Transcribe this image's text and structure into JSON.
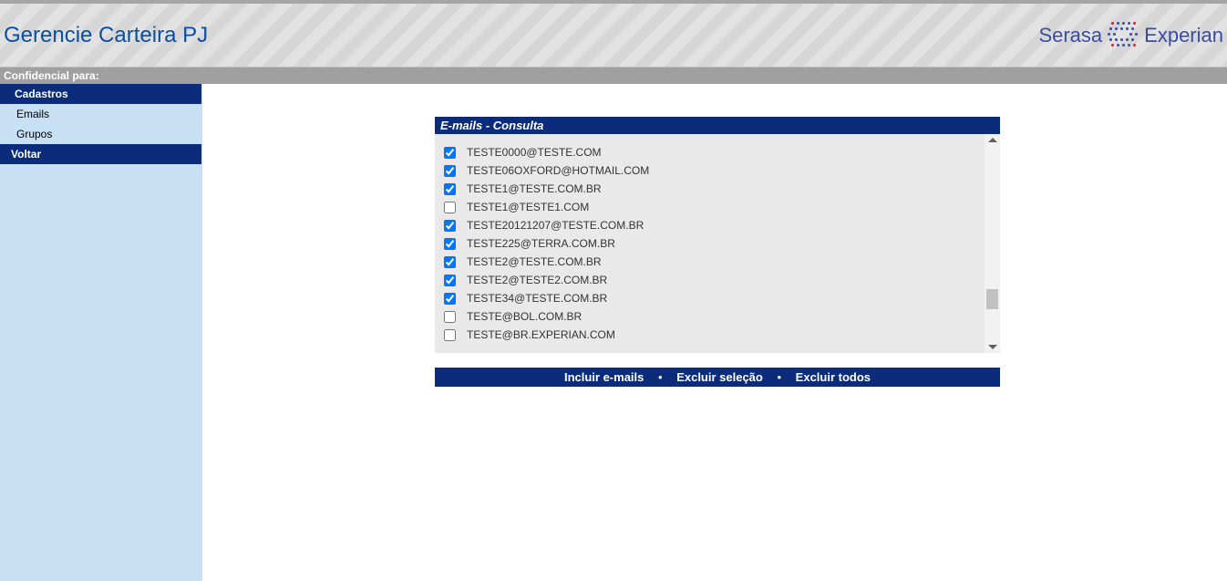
{
  "header": {
    "title": "Gerencie Carteira PJ",
    "logo_left": "Serasa",
    "logo_right": "Experian"
  },
  "conf_bar": "Confidencial para:",
  "sidebar": {
    "items": [
      {
        "label": "Cadastros",
        "kind": "header"
      },
      {
        "label": "Emails",
        "kind": "sub"
      },
      {
        "label": "Grupos",
        "kind": "sub"
      },
      {
        "label": "Voltar",
        "kind": "voltar"
      }
    ]
  },
  "panel": {
    "title": "E-mails - Consulta",
    "emails": [
      {
        "checked": true,
        "addr": "TESTE0000@TESTE.COM"
      },
      {
        "checked": true,
        "addr": "TESTE06OXFORD@HOTMAIL.COM"
      },
      {
        "checked": true,
        "addr": "TESTE1@TESTE.COM.BR"
      },
      {
        "checked": false,
        "addr": "TESTE1@TESTE1.COM"
      },
      {
        "checked": true,
        "addr": "TESTE20121207@TESTE.COM.BR"
      },
      {
        "checked": true,
        "addr": "TESTE225@TERRA.COM.BR"
      },
      {
        "checked": true,
        "addr": "TESTE2@TESTE.COM.BR"
      },
      {
        "checked": true,
        "addr": "TESTE2@TESTE2.COM.BR"
      },
      {
        "checked": true,
        "addr": "TESTE34@TESTE.COM.BR"
      },
      {
        "checked": false,
        "addr": "TESTE@BOL.COM.BR"
      },
      {
        "checked": false,
        "addr": "TESTE@BR.EXPERIAN.COM"
      }
    ],
    "actions": {
      "include": "Incluir e-mails",
      "exclude_sel": "Excluir seleção",
      "exclude_all": "Excluir todos",
      "sep": "•"
    }
  }
}
